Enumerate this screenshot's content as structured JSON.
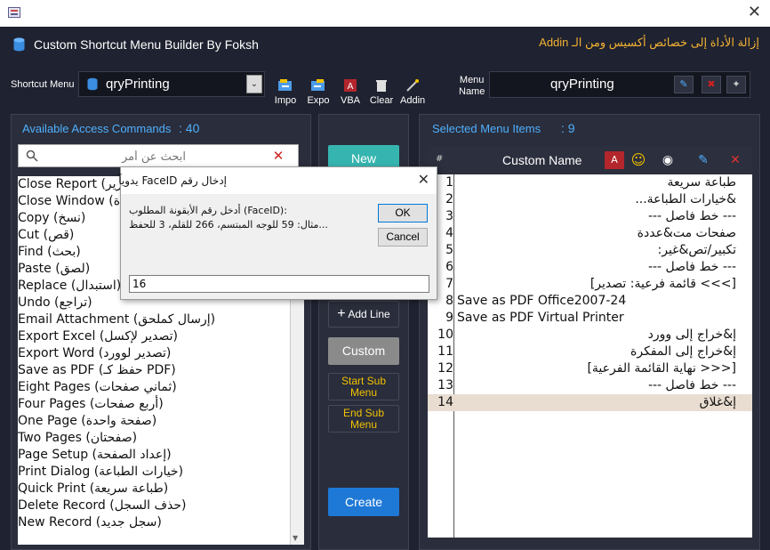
{
  "window": {
    "close_glyph": "✕"
  },
  "header": {
    "title": "Custom Shortcut Menu Builder By Foksh",
    "remove_addin": "إزالة الأداة إلى خصائص أكسيس ومن الـ Addin"
  },
  "shortcut_menu": {
    "label": "Shortcut Menu",
    "value": "qryPrinting"
  },
  "toolbar": [
    {
      "label": "Impo",
      "icon": "import-icon"
    },
    {
      "label": "Expo",
      "icon": "export-icon"
    },
    {
      "label": "VBA",
      "icon": "vba-icon"
    },
    {
      "label": "Clear",
      "icon": "trash-icon"
    },
    {
      "label": "Addin",
      "icon": "wand-icon"
    }
  ],
  "menu_name": {
    "label_line1": "Menu",
    "label_line2": "Name",
    "value": "qryPrinting"
  },
  "available": {
    "label": "Available Access Commands",
    "count": ": 40",
    "search_placeholder": "ابحث عن أمر",
    "clear_glyph": "✕",
    "items": [
      "Close Report (إغلاق التقرير)",
      "Close Window (إغلاق النافذة)",
      "Copy (نسخ)",
      "Cut (قص)",
      "Find (بحث)",
      "Paste (لصق)",
      "Replace (استبدال)",
      "Undo (تراجع)",
      "Email Attachment (إرسال كملحق)",
      "Export Excel (تصدير لإكسل)",
      "Export Word (تصدير لوورد)",
      "Save as PDF (حفظ كـ PDF)",
      "Eight Pages (ثماني صفحات)",
      "Four Pages (أربع صفحات)",
      "One Page (صفحة واحدة)",
      "Two Pages (صفحتان)",
      "Page Setup (إعداد الصفحة)",
      "Print Dialog (خيارات الطباعة)",
      "Quick Print (طباعة سريعة)",
      "Delete Record (حذف السجل)",
      "New Record (سجل جديد)"
    ]
  },
  "middle": {
    "new": "New",
    "add_line": "Add Line",
    "custom": "Custom",
    "start_sub_1": "Start Sub",
    "start_sub_2": "Menu",
    "end_sub_1": "End Sub",
    "end_sub_2": "Menu",
    "create": "Create"
  },
  "selected": {
    "label": "Selected Menu Items",
    "count": ": 9",
    "col_hash": "#",
    "col_name": "Custom Name",
    "rows": [
      {
        "n": "1",
        "text": "طباعة سريعة",
        "rtl": true
      },
      {
        "n": "2",
        "text": "&خيارات الطباعة...",
        "rtl": true
      },
      {
        "n": "3",
        "text": "--- خط فاصل ---",
        "rtl": true
      },
      {
        "n": "4",
        "text": "صفحات مت&عددة",
        "rtl": true
      },
      {
        "n": "5",
        "text": "تكبير/تص&غير:",
        "rtl": true
      },
      {
        "n": "6",
        "text": "--- خط فاصل ---",
        "rtl": true
      },
      {
        "n": "7",
        "text": "[>>> قائمة فرعية: تصدير]",
        "rtl": true
      },
      {
        "n": "8",
        "text": "Save as PDF  Office2007-24",
        "rtl": false
      },
      {
        "n": "9",
        "text": "Save as PDF  Virtual Printer",
        "rtl": false
      },
      {
        "n": "10",
        "text": "إ&خراج إلى وورد",
        "rtl": true
      },
      {
        "n": "11",
        "text": "إ&خراج إلى المفكرة",
        "rtl": true
      },
      {
        "n": "12",
        "text": "[<<< نهاية القائمة الفرعية]",
        "rtl": true
      },
      {
        "n": "13",
        "text": "--- خط فاصل ---",
        "rtl": true
      },
      {
        "n": "14",
        "text": "إ&غلاق",
        "rtl": true
      }
    ]
  },
  "dialog": {
    "title": "إدخال رقم FaceID يدوياً",
    "prompt_line1": "أدخل رقم الأيقونة المطلوب (FaceID):",
    "prompt_line2": "مثال: 59 للوجه المبتسم، 266 للقلم، 3 للحفظ...",
    "ok": "OK",
    "cancel": "Cancel",
    "input_value": "16",
    "close_glyph": "✕"
  },
  "colors": {
    "accent_teal": "#36b5b0",
    "create_blue": "#1e78d6",
    "header_label_blue": "#4fb0ff",
    "warning_orange": "#f2b233",
    "sub_yellow": "#f2c200"
  }
}
